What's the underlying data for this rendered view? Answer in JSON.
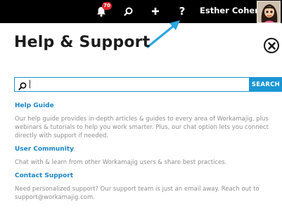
{
  "topbar": {
    "notification_count": "70",
    "help_label": "?",
    "user_name": "Esther Cohen"
  },
  "page": {
    "title": "Help & Support"
  },
  "search": {
    "placeholder": "",
    "value": "",
    "button_label": "SEARCH"
  },
  "sections": [
    {
      "title": "Help Guide",
      "description": "Our help guide provides in-depth articles & guides to every area of Workamajig, plus webinars & tutorials to help you work smarter. Plus, our chat option lets you connect directly with support if needed."
    },
    {
      "title": "User Community",
      "description": "Chat with & learn from other Workamajig users & share best practices."
    },
    {
      "title": "Contact Support",
      "description": "Need personalized support? Our support team is just an email away. Reach out to support@workamajig.com."
    }
  ],
  "colors": {
    "topbar_bg": "#000000",
    "accent_blue": "#1a96d4",
    "link_blue": "#1a86c8",
    "badge_red": "#e0252b",
    "annotation_arrow": "#2aa5e0"
  },
  "icons": {
    "bell": "bell-icon",
    "search": "search-icon",
    "plus": "plus-icon",
    "help": "help-icon",
    "close": "close-icon",
    "avatar": "avatar"
  }
}
